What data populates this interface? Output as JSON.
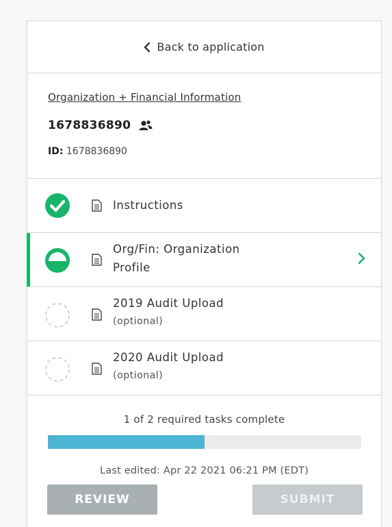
{
  "header": {
    "back_label": "Back to application"
  },
  "organization": {
    "link_label": "Organization + Financial Information",
    "number": "1678836890",
    "id_label": "ID:",
    "id_value": "1678836890"
  },
  "tasks": [
    {
      "label": "Instructions",
      "sub": "",
      "status": "complete"
    },
    {
      "label": "Org/Fin: Organization",
      "label2": "Profile",
      "sub": "",
      "status": "in-progress"
    },
    {
      "label": "2019 Audit Upload",
      "sub": "(optional)",
      "status": "not-started"
    },
    {
      "label": "2020 Audit Upload",
      "sub": "(optional)",
      "status": "not-started"
    }
  ],
  "progress": {
    "text": "1 of 2 required tasks complete",
    "fraction": 0.5,
    "last_edited": "Last edited: Apr 22 2021 06:21 PM (EDT)"
  },
  "actions": {
    "review_label": "REVIEW",
    "submit_label": "SUBMIT"
  },
  "colors": {
    "accent_green": "#17b46a",
    "progress_blue": "#4cb5d4",
    "button_gray": "#a9b0b4"
  },
  "icons": {
    "back": "chevron-left-icon",
    "users": "users-icon",
    "document": "document-icon",
    "complete": "check-circle-icon",
    "in_progress": "half-circle-icon",
    "not_started": "dashed-circle-icon",
    "next": "chevron-right-icon"
  }
}
